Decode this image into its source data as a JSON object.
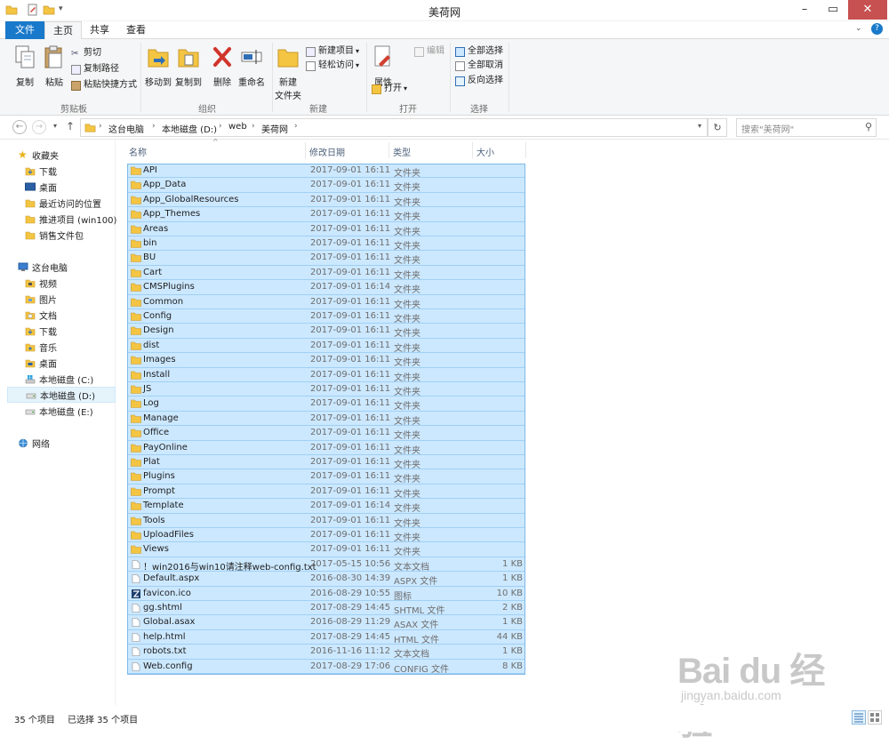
{
  "window": {
    "title": "美荷网"
  },
  "ribbon_tabs": {
    "file": "文件",
    "home": "主页",
    "share": "共享",
    "view": "查看"
  },
  "ribbon": {
    "clipboard": {
      "label": "剪贴板",
      "copy": "复制",
      "paste": "粘贴",
      "cut": "剪切",
      "copy_path": "复制路径",
      "paste_shortcut": "粘贴快捷方式"
    },
    "organize": {
      "label": "组织",
      "move_to": "移动到",
      "copy_to": "复制到",
      "delete": "删除",
      "rename": "重命名"
    },
    "new": {
      "label": "新建",
      "new_folder_line1": "新建",
      "new_folder_line2": "文件夹",
      "new_item": "新建项目",
      "easy_access": "轻松访问"
    },
    "open": {
      "label": "打开",
      "properties": "属性",
      "open": "打开",
      "edit": "编辑"
    },
    "select": {
      "label": "选择",
      "select_all": "全部选择",
      "select_none": "全部取消",
      "invert": "反向选择"
    }
  },
  "address": {
    "crumbs": [
      "这台电脑",
      "本地磁盘 (D:)",
      "web",
      "美荷网"
    ],
    "search_placeholder": "搜索\"美荷网\""
  },
  "nav": {
    "favorites": "收藏夹",
    "fav_items": [
      "下载",
      "桌面",
      "最近访问的位置",
      "推进项目 (win100)",
      "销售文件包"
    ],
    "this_pc": "这台电脑",
    "pc_items": [
      "视频",
      "图片",
      "文档",
      "下载",
      "音乐",
      "桌面",
      "本地磁盘 (C:)",
      "本地磁盘 (D:)",
      "本地磁盘 (E:)"
    ],
    "network": "网络"
  },
  "columns": {
    "name": "名称",
    "date": "修改日期",
    "type": "类型",
    "size": "大小"
  },
  "files": [
    {
      "name": "API",
      "date": "2017-09-01 16:11",
      "type": "文件夹",
      "size": "",
      "kind": "folder"
    },
    {
      "name": "App_Data",
      "date": "2017-09-01 16:11",
      "type": "文件夹",
      "size": "",
      "kind": "folder"
    },
    {
      "name": "App_GlobalResources",
      "date": "2017-09-01 16:11",
      "type": "文件夹",
      "size": "",
      "kind": "folder"
    },
    {
      "name": "App_Themes",
      "date": "2017-09-01 16:11",
      "type": "文件夹",
      "size": "",
      "kind": "folder"
    },
    {
      "name": "Areas",
      "date": "2017-09-01 16:11",
      "type": "文件夹",
      "size": "",
      "kind": "folder"
    },
    {
      "name": "bin",
      "date": "2017-09-01 16:11",
      "type": "文件夹",
      "size": "",
      "kind": "folder"
    },
    {
      "name": "BU",
      "date": "2017-09-01 16:11",
      "type": "文件夹",
      "size": "",
      "kind": "folder"
    },
    {
      "name": "Cart",
      "date": "2017-09-01 16:11",
      "type": "文件夹",
      "size": "",
      "kind": "folder"
    },
    {
      "name": "CMSPlugins",
      "date": "2017-09-01 16:14",
      "type": "文件夹",
      "size": "",
      "kind": "folder"
    },
    {
      "name": "Common",
      "date": "2017-09-01 16:11",
      "type": "文件夹",
      "size": "",
      "kind": "folder"
    },
    {
      "name": "Config",
      "date": "2017-09-01 16:11",
      "type": "文件夹",
      "size": "",
      "kind": "folder"
    },
    {
      "name": "Design",
      "date": "2017-09-01 16:11",
      "type": "文件夹",
      "size": "",
      "kind": "folder"
    },
    {
      "name": "dist",
      "date": "2017-09-01 16:11",
      "type": "文件夹",
      "size": "",
      "kind": "folder"
    },
    {
      "name": "Images",
      "date": "2017-09-01 16:11",
      "type": "文件夹",
      "size": "",
      "kind": "folder"
    },
    {
      "name": "Install",
      "date": "2017-09-01 16:11",
      "type": "文件夹",
      "size": "",
      "kind": "folder"
    },
    {
      "name": "JS",
      "date": "2017-09-01 16:11",
      "type": "文件夹",
      "size": "",
      "kind": "folder"
    },
    {
      "name": "Log",
      "date": "2017-09-01 16:11",
      "type": "文件夹",
      "size": "",
      "kind": "folder"
    },
    {
      "name": "Manage",
      "date": "2017-09-01 16:11",
      "type": "文件夹",
      "size": "",
      "kind": "folder"
    },
    {
      "name": "Office",
      "date": "2017-09-01 16:11",
      "type": "文件夹",
      "size": "",
      "kind": "folder"
    },
    {
      "name": "PayOnline",
      "date": "2017-09-01 16:11",
      "type": "文件夹",
      "size": "",
      "kind": "folder"
    },
    {
      "name": "Plat",
      "date": "2017-09-01 16:11",
      "type": "文件夹",
      "size": "",
      "kind": "folder"
    },
    {
      "name": "Plugins",
      "date": "2017-09-01 16:11",
      "type": "文件夹",
      "size": "",
      "kind": "folder"
    },
    {
      "name": "Prompt",
      "date": "2017-09-01 16:11",
      "type": "文件夹",
      "size": "",
      "kind": "folder"
    },
    {
      "name": "Template",
      "date": "2017-09-01 16:14",
      "type": "文件夹",
      "size": "",
      "kind": "folder"
    },
    {
      "name": "Tools",
      "date": "2017-09-01 16:11",
      "type": "文件夹",
      "size": "",
      "kind": "folder"
    },
    {
      "name": "UploadFiles",
      "date": "2017-09-01 16:11",
      "type": "文件夹",
      "size": "",
      "kind": "folder"
    },
    {
      "name": "Views",
      "date": "2017-09-01 16:11",
      "type": "文件夹",
      "size": "",
      "kind": "folder"
    },
    {
      "name": "！win2016与win10请注释web-config.txt",
      "date": "2017-05-15 10:56",
      "type": "文本文档",
      "size": "1 KB",
      "kind": "text"
    },
    {
      "name": "Default.aspx",
      "date": "2016-08-30 14:39",
      "type": "ASPX 文件",
      "size": "1 KB",
      "kind": "file"
    },
    {
      "name": "favicon.ico",
      "date": "2016-08-29 10:55",
      "type": "图标",
      "size": "10 KB",
      "kind": "icon"
    },
    {
      "name": "gg.shtml",
      "date": "2017-08-29 14:45",
      "type": "SHTML 文件",
      "size": "2 KB",
      "kind": "file"
    },
    {
      "name": "Global.asax",
      "date": "2016-08-29 11:29",
      "type": "ASAX 文件",
      "size": "1 KB",
      "kind": "file"
    },
    {
      "name": "help.html",
      "date": "2017-08-29 14:45",
      "type": "HTML 文件",
      "size": "44 KB",
      "kind": "file"
    },
    {
      "name": "robots.txt",
      "date": "2016-11-16 11:12",
      "type": "文本文档",
      "size": "1 KB",
      "kind": "text"
    },
    {
      "name": "Web.config",
      "date": "2017-08-29 17:06",
      "type": "CONFIG 文件",
      "size": "8 KB",
      "kind": "file"
    }
  ],
  "status": {
    "count": "35 个项目",
    "selected": "已选择 35 个项目"
  },
  "watermark": {
    "logo": "Bai du 经验",
    "url": "jingyan.baidu.com"
  },
  "colors": {
    "accent": "#1979ca",
    "selection": "#cce8ff",
    "folder": "#f4c542"
  }
}
